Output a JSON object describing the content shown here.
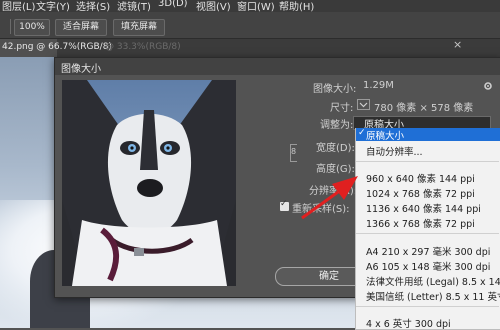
{
  "menu": [
    "图层(L)",
    "文字(Y)",
    "选择(S)",
    "滤镜(T)",
    "3D(D)",
    "视图(V)",
    "窗口(W)",
    "帮助(H)"
  ],
  "options": {
    "zoom": "100%",
    "fit_screen": "适合屏幕",
    "fill_screen": "填充屏幕"
  },
  "document_tab": "42.png @ 66.7%(RGB/8)",
  "faded_tab": "@ 33.3%(RGB/8)",
  "tab_close_glyph": "×",
  "dialog": {
    "title": "图像大小",
    "image_size_label": "图像大小:",
    "image_size_value": "1.29M",
    "dimensions_label": "尺寸:",
    "dimensions_value": "780 像素 × 578 像素",
    "fit_to_label": "调整为:",
    "fit_to_value": "原稿大小",
    "width_label": "宽度(D):",
    "height_label": "高度(G):",
    "resolution_label": "分辨率(R):",
    "resample_label": "重新采样(S):",
    "ok_label": "确定",
    "link_glyph": "8"
  },
  "dropdown": {
    "items": [
      "原稿大小",
      "自动分辨率...",
      "960 x 640 像素 144 ppi",
      "1024 x 768 像素 72 ppi",
      "1136 x 640 像素 144 ppi",
      "1366 x 768 像素 72 ppi",
      "A4 210 x 297 毫米 300 dpi",
      "A6 105 x 148 毫米 300 dpi",
      "法律文件用纸 (Legal) 8.5 x 14 英寸",
      "美国信纸 (Letter) 8.5 x 11 英寸 3",
      "4 x 6 英寸 300 dpi"
    ],
    "selected_index": 0
  },
  "icons": {
    "gear": "gear-icon",
    "check": "check-icon",
    "link": "link-chain-icon",
    "arrow": "red-arrow-annotation",
    "close": "close-icon"
  },
  "colors": {
    "menu_highlight": "#1f6fd6",
    "annotation_arrow": "#e02020"
  }
}
